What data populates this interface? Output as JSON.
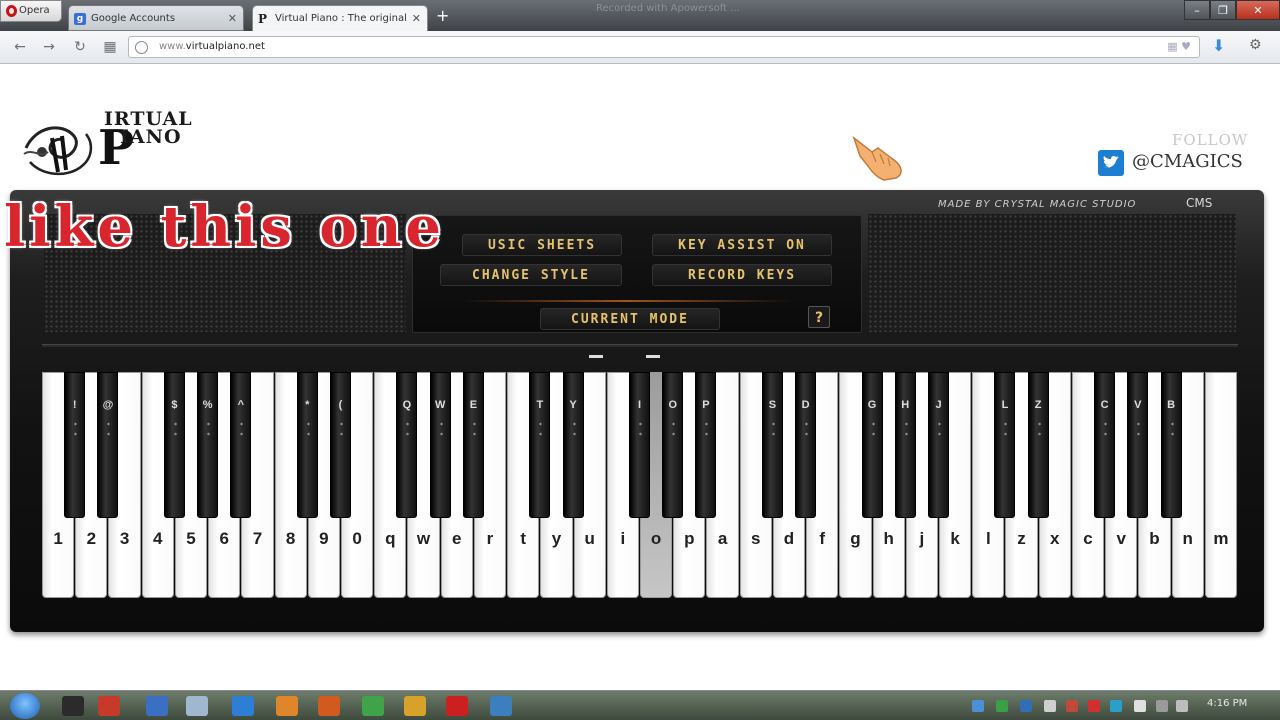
{
  "browser": {
    "menu_label": "Opera",
    "tabs": [
      {
        "label": "Google Accounts",
        "favicon": "google-icon"
      },
      {
        "label": "Virtual Piano : The original",
        "favicon": "virtualpiano-icon"
      }
    ],
    "window_title": "Recorded with Apowersoft ...",
    "url_prefix": "www.",
    "url_domain": "virtualpiano.net"
  },
  "header": {
    "logo_word1": "IRTUAL",
    "logo_word2": "IANO",
    "logo_letter": "P",
    "follow_label": "FOLLOW",
    "twitter_handle": "@CMAGICS"
  },
  "panel": {
    "made_by": "MADE BY CRYSTAL MAGIC STUDIO",
    "cms_mark": "CMS",
    "buttons": {
      "music_sheets": "USIC SHEETS",
      "key_assist": "KEY ASSIST ON",
      "change_style": "CHANGE STYLE",
      "record_keys": "RECORD KEYS",
      "current_mode": "CURRENT MODE",
      "help": "?"
    },
    "overlay_text": "like this one"
  },
  "keyboard": {
    "accent_pressed": "#b4b4b4",
    "pressed_key": "o",
    "white_keys": [
      "1",
      "2",
      "3",
      "4",
      "5",
      "6",
      "7",
      "8",
      "9",
      "0",
      "q",
      "w",
      "e",
      "r",
      "t",
      "y",
      "u",
      "i",
      "o",
      "p",
      "a",
      "s",
      "d",
      "f",
      "g",
      "h",
      "j",
      "k",
      "l",
      "z",
      "x",
      "c",
      "v",
      "b",
      "n",
      "m"
    ],
    "black_keys": [
      "!",
      "@",
      "$",
      "%",
      "^",
      "*",
      "(",
      "Q",
      "W",
      "E",
      "T",
      "Y",
      "I",
      "O",
      "P",
      "S",
      "D",
      "G",
      "H",
      "J",
      "L",
      "Z",
      "C",
      "V",
      "B"
    ]
  },
  "taskbar": {
    "clock": "4:16 PM"
  },
  "colors": {
    "console_text": "#e6c36a",
    "overlay_red": "#d9252e",
    "twitter_blue": "#1c7fd0"
  }
}
